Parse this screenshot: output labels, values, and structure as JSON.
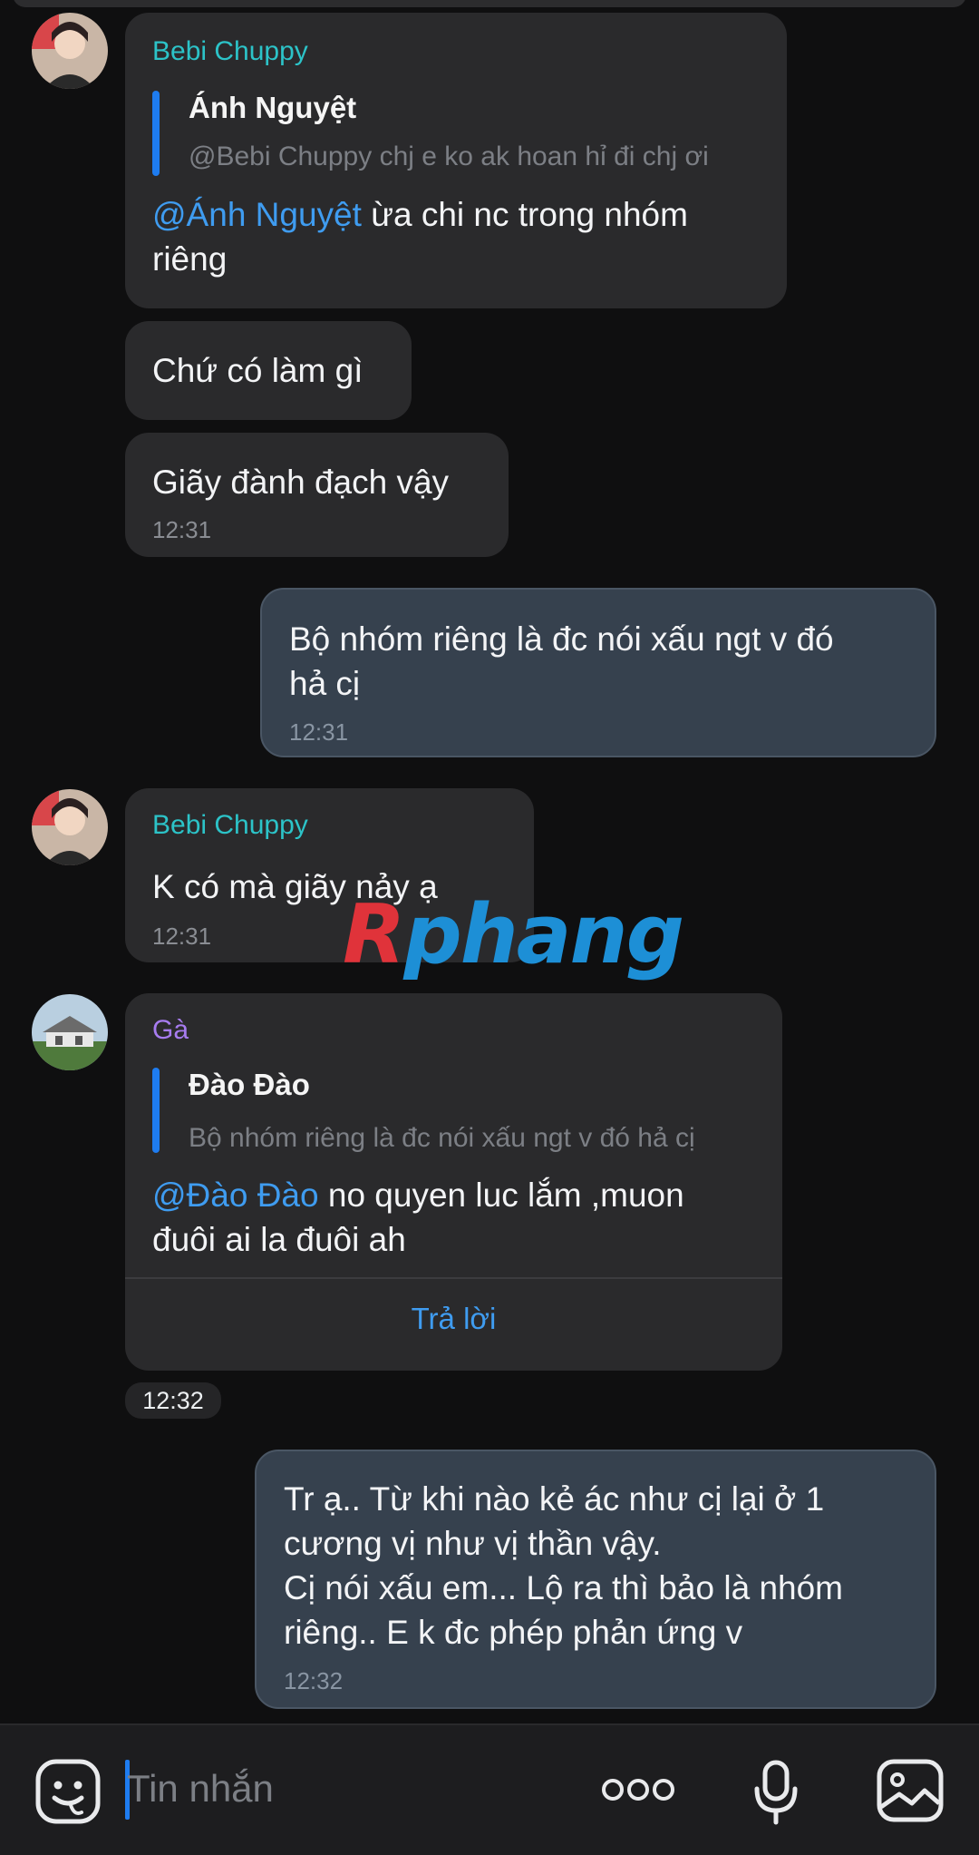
{
  "messages": {
    "m1": {
      "sender": "Bebi Chuppy",
      "quote_name": "Ánh Nguyệt",
      "quote_text": "@Bebi Chuppy chj e ko ak hoan hỉ đi chj ơi",
      "mention": "@Ánh Nguyệt",
      "text_line1": " ừa chi nc trong nhóm",
      "text_line2": "riêng"
    },
    "m2": {
      "text": "Chứ có làm gì"
    },
    "m3": {
      "text": "Giãy đành đạch vậy",
      "time": "12:31"
    },
    "m4": {
      "text_line1": "Bộ nhóm riêng là đc nói xấu ngt v đó",
      "text_line2": "hả cị",
      "time": "12:31"
    },
    "m5": {
      "sender": "Bebi Chuppy",
      "text": "K có mà giãy nảy ạ",
      "time": "12:31"
    },
    "m6": {
      "sender": "Gà",
      "quote_name": "Đào Đào",
      "quote_text": "Bộ nhóm riêng là đc nói xấu ngt v đó hả cị",
      "mention": "@Đào Đào",
      "text_line1": " no quyen luc lắm ,muon",
      "text_line2": "đuôi ai la đuôi ah",
      "reply_label": "Trả lời"
    },
    "time_pill": "12:32",
    "m7": {
      "line1": "Tr ạ.. Từ khi nào kẻ ác như cị lại ở 1",
      "line2": "cương vị như vị thần vậy.",
      "line3": "Cị nói xấu em... Lộ ra thì bảo là nhóm",
      "line4": "riêng.. E k đc phép phản ứng v",
      "time": "12:32"
    }
  },
  "watermark": {
    "r": "R",
    "rest": "phang"
  },
  "input": {
    "placeholder": "Tin nhắn"
  },
  "icons": {
    "sticker": "sticker-face-icon",
    "more": "more-dots-icon",
    "mic": "microphone-icon",
    "gallery": "image-gallery-icon"
  },
  "colors": {
    "background": "#0f0f10",
    "incoming_bubble": "#2a2a2c",
    "outgoing_bubble": "#36414e",
    "accent_blue": "#1e7cf0",
    "sender_teal": "#2cc3c8",
    "sender_purple": "#a77cf0"
  }
}
